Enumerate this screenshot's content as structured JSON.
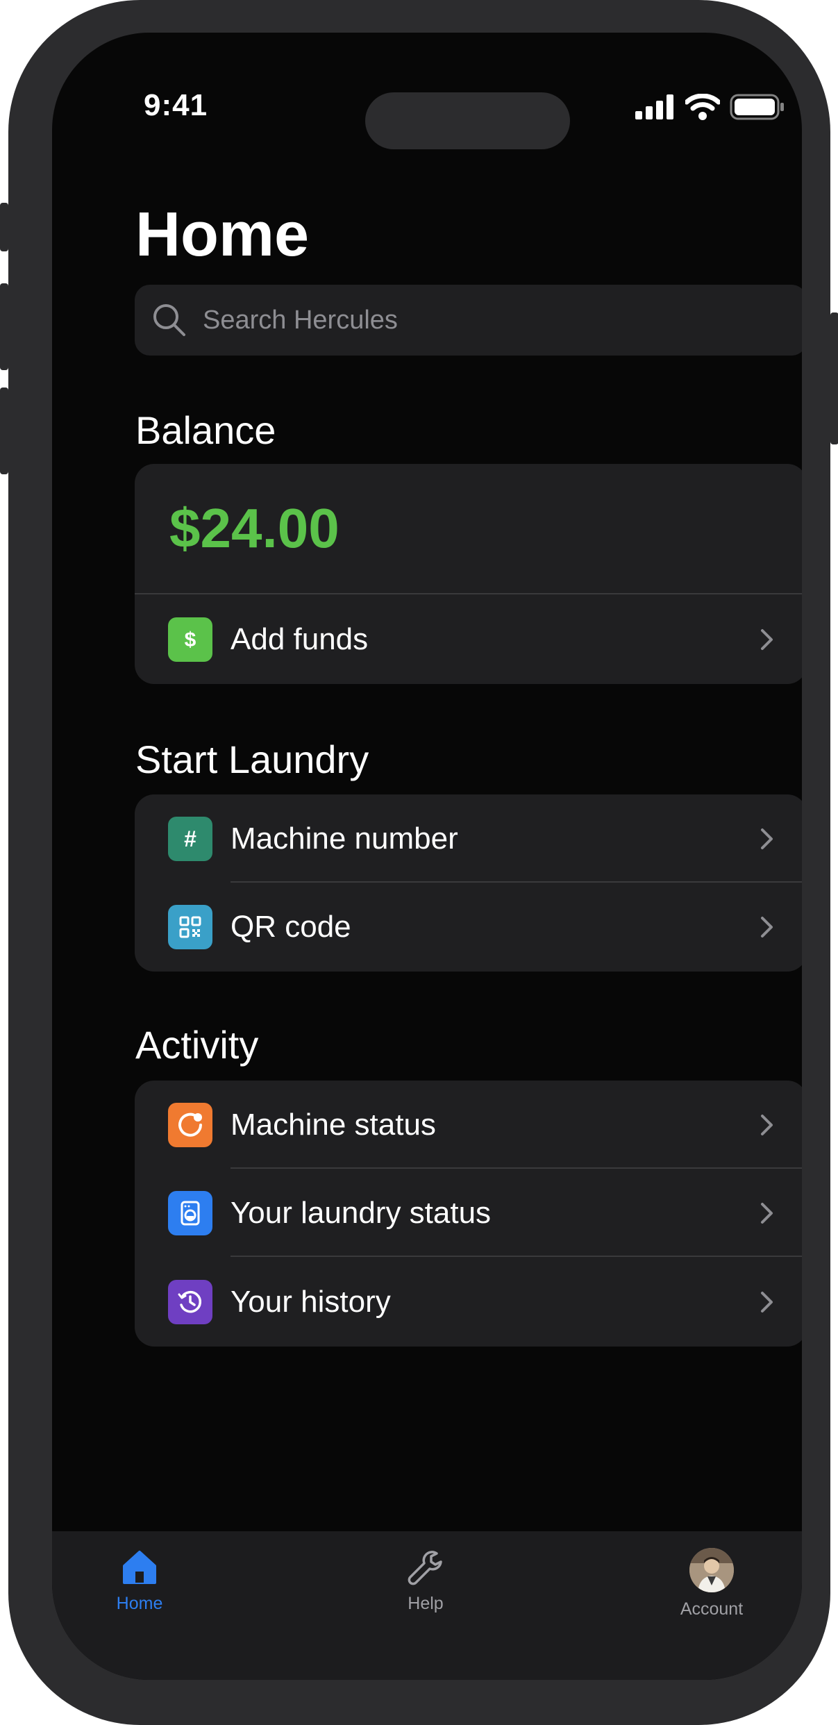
{
  "status_bar": {
    "time": "9:41"
  },
  "header": {
    "title": "Home"
  },
  "search": {
    "placeholder": "Search Hercules"
  },
  "balance": {
    "title": "Balance",
    "amount": "$24.00",
    "add_funds_label": "Add funds",
    "accent_color": "#5bc24a"
  },
  "start_laundry": {
    "title": "Start Laundry",
    "items": [
      {
        "label": "Machine number",
        "icon": "hash-icon",
        "color": "#2e8a6d"
      },
      {
        "label": "QR code",
        "icon": "qr-code-icon",
        "color": "#3aa0c8"
      }
    ]
  },
  "activity": {
    "title": "Activity",
    "items": [
      {
        "label": "Machine status",
        "icon": "machine-status-icon",
        "color": "#f07a30"
      },
      {
        "label": "Your laundry status",
        "icon": "washer-icon",
        "color": "#2d7ef0"
      },
      {
        "label": "Your history",
        "icon": "history-clock-icon",
        "color": "#6f3fc2"
      }
    ]
  },
  "tab_bar": {
    "home_label": "Home",
    "help_label": "Help",
    "account_label": "Account",
    "active_color": "#2d7ef0",
    "inactive_color": "#a0a0a5"
  }
}
